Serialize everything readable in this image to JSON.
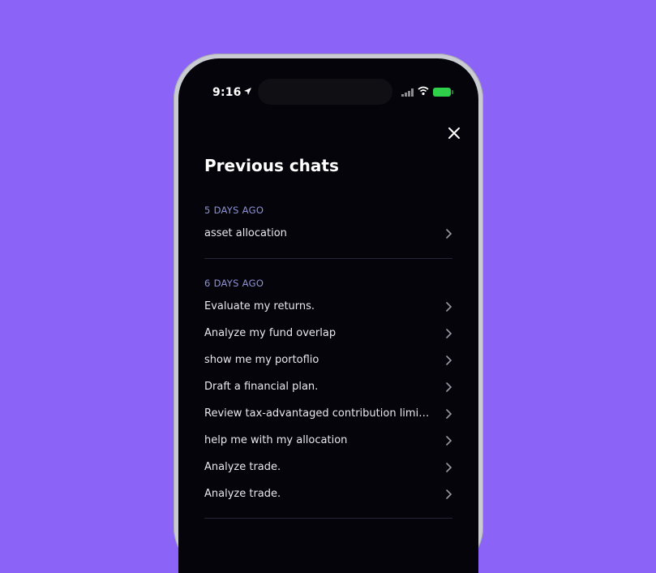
{
  "status_bar": {
    "time": "9:16"
  },
  "icons": {
    "location": "location-arrow-icon",
    "signal": "cellular-signal-icon",
    "wifi": "wifi-icon",
    "battery": "battery-icon",
    "close": "close-icon",
    "chevron": "chevron-right-icon"
  },
  "colors": {
    "background": "#8b63f6",
    "screen": "#04040a",
    "section_label": "#8f93d6",
    "battery": "#2fd14a"
  },
  "page": {
    "title": "Previous chats"
  },
  "sections": [
    {
      "label": "5 DAYS AGO",
      "items": [
        "asset allocation"
      ]
    },
    {
      "label": "6 DAYS AGO",
      "items": [
        "Evaluate my returns.",
        "Analyze my fund overlap",
        "show me my portoflio",
        "Draft a financial plan.",
        "Review tax-advantaged contribution limits a...",
        "help me with my allocation",
        "Analyze trade.",
        "Analyze trade."
      ]
    }
  ]
}
